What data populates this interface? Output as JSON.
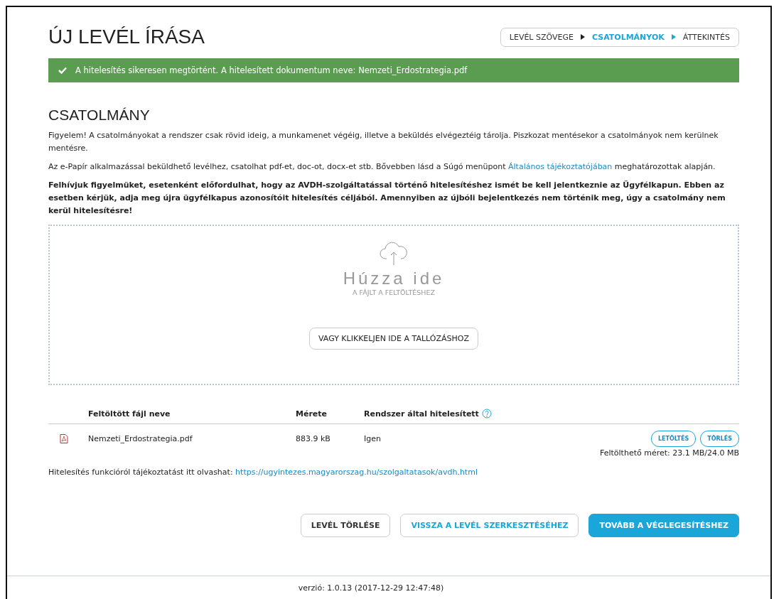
{
  "page_title": "ÚJ LEVÉL ÍRÁSA",
  "steps": [
    {
      "label": "LEVÉL SZÖVEGE",
      "selected": false
    },
    {
      "label": "CSATOLMÁNYOK",
      "selected": true
    },
    {
      "label": "ÁTTEKINTÉS",
      "selected": false
    }
  ],
  "alert": {
    "text": "A hitelesítés sikeresen megtörtént. A hitelesített dokumentum neve: Nemzeti_Erdostrategia.pdf"
  },
  "section_title": "CSATOLMÁNY",
  "notice": "Figyelem! A csatolmányokat a rendszer csak rövid ideig, a munkamenet végéig, illetve a beküldés elvégeztéig tárolja. Piszkozat mentésekor a csatolmányok nem kerülnek mentésre.",
  "info": {
    "before": "Az e-Papír alkalmazással beküldhető levélhez, csatolhat pdf-et, doc-ot, docx-et stb. Bővebben lásd a Súgó menüpont",
    "link": "Általános tájékoztatójában",
    "after": "meghatározottak alapján."
  },
  "warning": "Felhívjuk figyelmüket, esetenként előfordulhat, hogy az AVDH-szolgáltatással történő hitelesítéshez ismét be kell jelentkeznie az Ügyfélkapun. Ebben az esetben kérjük, adja meg újra ügyfélkapus azonosítóit hitelesítés céljából. Amennyiben az újbóli bejelentkezés nem történik meg, úgy a csatolmány nem kerül hitelesítésre!",
  "dropzone": {
    "title": "Húzza ide",
    "subtitle": "A FÁJLT A FELTÖLTÉSHEZ",
    "browse_button": "VAGY KLIKKELJEN IDE A TALLÓZÁSHOZ"
  },
  "table": {
    "columns": [
      "Feltöltött fájl neve",
      "Mérete",
      "Rendszer által hitelesített"
    ],
    "rows": [
      {
        "name": "Nemzeti_Erdostrategia.pdf",
        "size": "883.9 kB",
        "verified": "Igen",
        "actions": [
          "LETÖLTÉS",
          "TÖRLÉS"
        ]
      }
    ]
  },
  "quota": "Feltölthető méret: 23.1 MB/24.0 MB",
  "avdh_info": {
    "text": "Hitelesítés funkcióról tájékoztatást itt olvashat:",
    "link": "https://ugyintezes.magyarorszag.hu/szolgaltatasok/avdh.html"
  },
  "buttons": [
    {
      "label": "LEVÉL TÖRLÉSE",
      "kind": "default"
    },
    {
      "label": "VISSZA A LEVÉL SZERKESZTÉSÉHEZ",
      "kind": "outline"
    },
    {
      "label": "TOVÁBB A VÉGLEGESÍTÉSHEZ",
      "kind": "primary"
    }
  ],
  "footer": "verzió: 1.0.13 (2017-12-29 12:47:48)"
}
